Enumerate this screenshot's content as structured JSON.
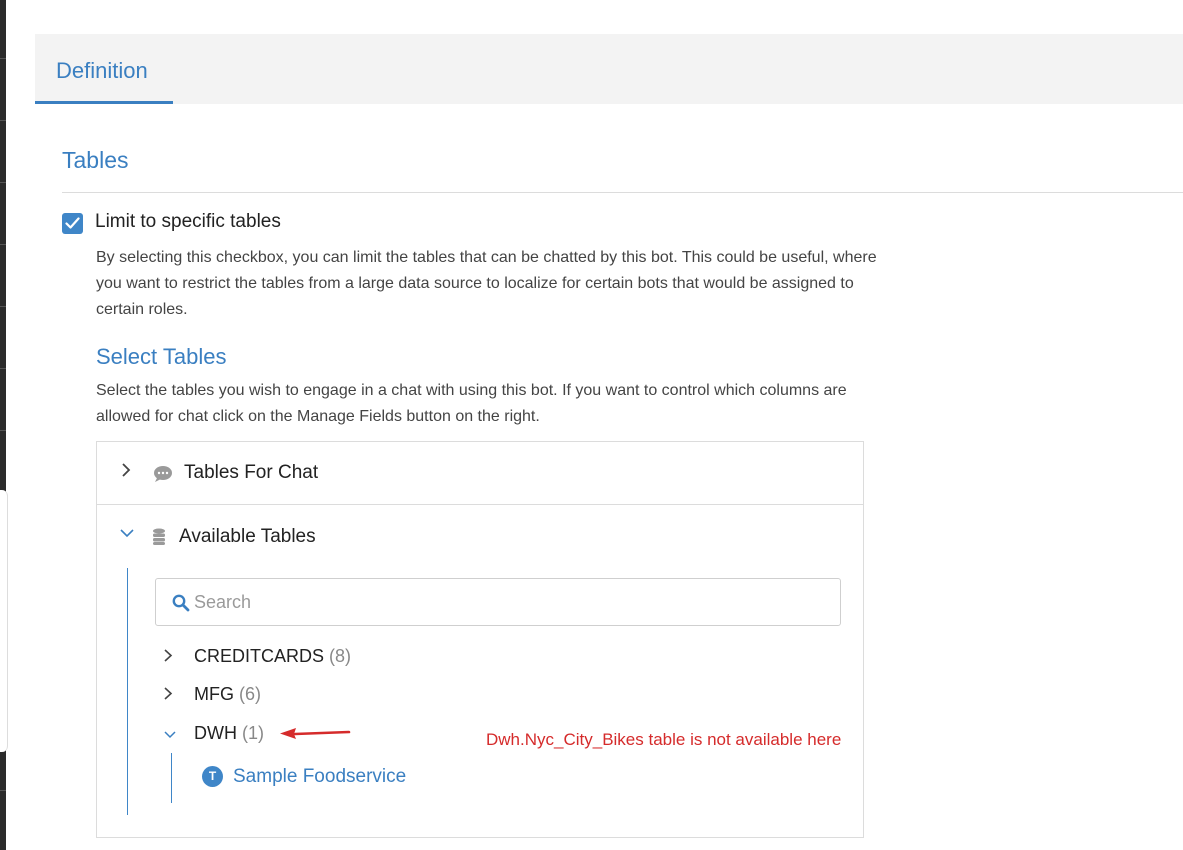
{
  "tabs": [
    {
      "label": "Definition",
      "active": true
    }
  ],
  "section": {
    "title": "Tables"
  },
  "limit": {
    "checked": true,
    "label": "Limit to specific tables",
    "description": "By selecting this checkbox, you can limit the tables that can be chatted by this bot. This could be useful, where you want to restrict the tables from a large data source to localize for certain bots that would be assigned to certain roles."
  },
  "select_tables": {
    "title": "Select Tables",
    "description": "Select the tables you wish to engage in a chat with using this bot. If you want to control which columns are allowed for chat click on the Manage Fields button on the right."
  },
  "tables_for_chat": {
    "label": "Tables For Chat",
    "icon": "chat-bubble-icon",
    "expanded": false
  },
  "available_tables": {
    "label": "Available Tables",
    "icon": "database-icon",
    "expanded": true,
    "search": {
      "placeholder": "Search",
      "value": ""
    },
    "groups": [
      {
        "name": "CREDITCARDS",
        "count": "(8)",
        "expanded": false
      },
      {
        "name": "MFG",
        "count": "(6)",
        "expanded": false
      },
      {
        "name": "DWH",
        "count": "(1)",
        "expanded": true,
        "tables": [
          {
            "badge": "T",
            "name": "Sample Foodservice"
          }
        ]
      }
    ]
  },
  "annotation": {
    "text": "Dwh.Nyc_City_Bikes table is not available here",
    "color": "#d52b2b"
  },
  "colors": {
    "accent": "#3a7fc1",
    "tab_bar": "#f3f3f3",
    "annotation": "#d52b2b"
  }
}
